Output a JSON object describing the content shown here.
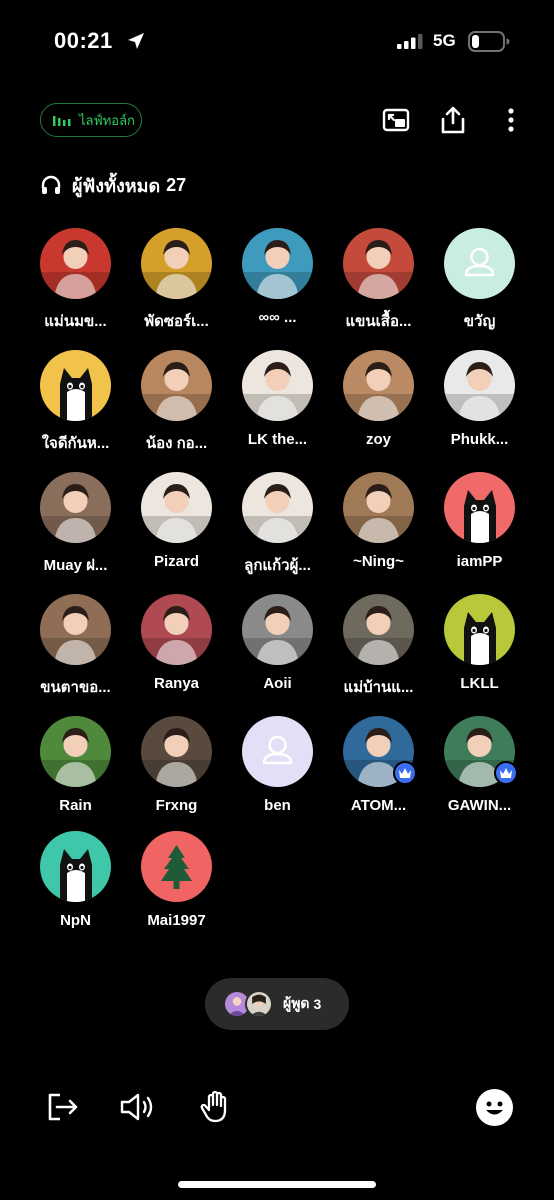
{
  "status_bar": {
    "time": "00:21",
    "network": "5G"
  },
  "header": {
    "live_label": "ไลฟ์ทอล์ก"
  },
  "listeners": {
    "title": "ผู้ฟังทั้งหมด",
    "count": "27"
  },
  "users": [
    {
      "name": "แม่นมข...",
      "avatar_color": "#c9382f",
      "crown": false,
      "icon": "photo-avatar"
    },
    {
      "name": "พัดซอร์เ...",
      "avatar_color": "#d4a02a",
      "crown": false,
      "icon": "photo-avatar"
    },
    {
      "name": "∞∞ ...",
      "avatar_color": "#3f9bbd",
      "crown": false,
      "icon": "photo-avatar"
    },
    {
      "name": "แขนเสื้อ...",
      "avatar_color": "#c44a3c",
      "crown": false,
      "icon": "photo-avatar"
    },
    {
      "name": "ขวัญ",
      "avatar_color": "#c9ede2",
      "crown": false,
      "icon": "default-person-avatar"
    },
    {
      "name": "ใจดีกันห...",
      "avatar_color": "#f2c34b",
      "crown": false,
      "icon": "cat-avatar"
    },
    {
      "name": "น้อง กอ...",
      "avatar_color": "#b9875f",
      "crown": false,
      "icon": "photo-avatar"
    },
    {
      "name": "LK the...",
      "avatar_color": "#ece6df",
      "crown": false,
      "icon": "photo-avatar"
    },
    {
      "name": "zoy",
      "avatar_color": "#b98a64",
      "crown": false,
      "icon": "photo-avatar"
    },
    {
      "name": "Phukk...",
      "avatar_color": "#e9e9e9",
      "crown": false,
      "icon": "photo-avatar"
    },
    {
      "name": "Muay ฝ...",
      "avatar_color": "#8a6e5c",
      "crown": false,
      "icon": "photo-avatar"
    },
    {
      "name": "Pizard",
      "avatar_color": "#ece6df",
      "crown": false,
      "icon": "photo-avatar"
    },
    {
      "name": "ลูกแก้วผู้...",
      "avatar_color": "#ece6df",
      "crown": false,
      "icon": "photo-avatar"
    },
    {
      "name": "~Ning~",
      "avatar_color": "#a07a56",
      "crown": false,
      "icon": "photo-avatar"
    },
    {
      "name": "iamPP",
      "avatar_color": "#f06a6a",
      "crown": false,
      "icon": "cat-avatar"
    },
    {
      "name": "ขนตาขอ...",
      "avatar_color": "#8f6e55",
      "crown": false,
      "icon": "photo-avatar"
    },
    {
      "name": "Ranya",
      "avatar_color": "#b04a52",
      "crown": false,
      "icon": "photo-avatar"
    },
    {
      "name": "Aoii",
      "avatar_color": "#8a8a8a",
      "crown": false,
      "icon": "photo-avatar"
    },
    {
      "name": "แม่บ้านแ...",
      "avatar_color": "#6f6a5e",
      "crown": false,
      "icon": "photo-avatar"
    },
    {
      "name": "LKLL",
      "avatar_color": "#b9c83a",
      "crown": false,
      "icon": "cat-avatar"
    },
    {
      "name": "Rain",
      "avatar_color": "#4f8a3c",
      "crown": false,
      "icon": "photo-avatar"
    },
    {
      "name": "Frxng",
      "avatar_color": "#5a4a3e",
      "crown": false,
      "icon": "photo-avatar"
    },
    {
      "name": "ben",
      "avatar_color": "#e4dff6",
      "crown": false,
      "icon": "default-person-avatar"
    },
    {
      "name": "ATOM...",
      "avatar_color": "#2f6a9a",
      "crown": true,
      "icon": "photo-avatar"
    },
    {
      "name": "GAWIN...",
      "avatar_color": "#3f7c5a",
      "crown": true,
      "icon": "photo-avatar"
    },
    {
      "name": "NpN",
      "avatar_color": "#3ec7a8",
      "crown": false,
      "icon": "cat-avatar"
    },
    {
      "name": "Mai1997",
      "avatar_color": "#f06464",
      "crown": false,
      "icon": "tree-avatar"
    }
  ],
  "speakers": {
    "label": "ผู้พูด",
    "count": "3"
  },
  "bottom_bar": {
    "icons": [
      "exit-icon",
      "speaker-icon",
      "raise-hand-icon",
      "emoji-icon"
    ]
  },
  "colors": {
    "accent_green": "#2ecc5f",
    "crown_badge": "#3a6df0",
    "background": "#000000"
  }
}
